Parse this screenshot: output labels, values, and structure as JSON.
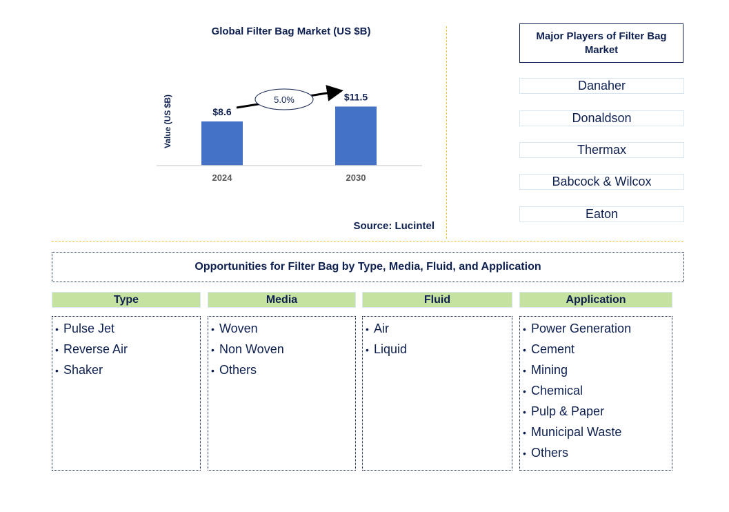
{
  "chart_data": {
    "type": "bar",
    "title": "Global Filter Bag Market (US $B)",
    "xlabel": "",
    "ylabel": "Value (US $B)",
    "categories": [
      "2024",
      "2030"
    ],
    "values": [
      8.6,
      11.5
    ],
    "data_labels": [
      "$8.6",
      "$11.5"
    ],
    "ylim": [
      0,
      14
    ],
    "grid": false,
    "bar_color": "#4472c4",
    "annotation": {
      "type": "cagr-arrow",
      "label": "5.0%",
      "from": "2024",
      "to": "2030"
    }
  },
  "source": "Source: Lucintel",
  "players": {
    "title": "Major Players of Filter Bag Market",
    "items": [
      "Danaher",
      "Donaldson",
      "Thermax",
      "Babcock & Wilcox",
      "Eaton"
    ]
  },
  "opportunities": {
    "title": "Opportunities for Filter Bag by Type, Media, Fluid, and Application",
    "categories": [
      {
        "label": "Type",
        "items": [
          "Pulse Jet",
          "Reverse Air",
          "Shaker"
        ]
      },
      {
        "label": "Media",
        "items": [
          "Woven",
          "Non Woven",
          "Others"
        ]
      },
      {
        "label": "Fluid",
        "items": [
          "Air",
          "Liquid"
        ]
      },
      {
        "label": "Application",
        "items": [
          "Power Generation",
          "Cement",
          "Mining",
          "Chemical",
          "Pulp & Paper",
          "Municipal Waste",
          "Others"
        ]
      }
    ]
  },
  "colors": {
    "text": "#0d1f4f",
    "bar": "#4472c4",
    "header_fill": "#c6e2a0",
    "divider": "#f2c12e"
  }
}
